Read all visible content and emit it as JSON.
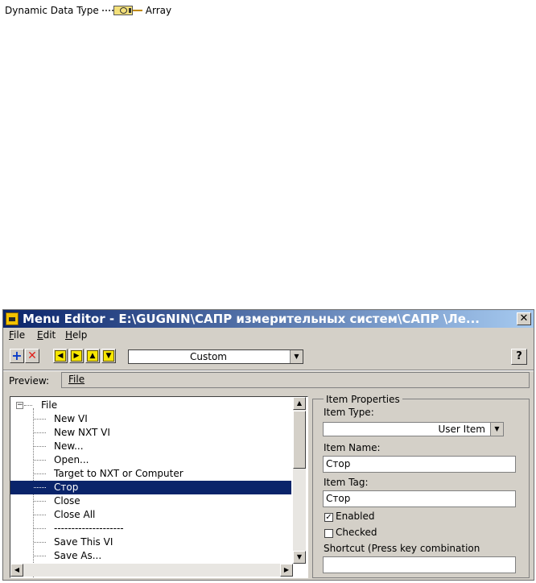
{
  "diagram": {
    "input_label": "Dynamic Data Type",
    "output_label": "Array"
  },
  "window": {
    "title": "Menu Editor - E:\\GUGNIN\\САПР измерительных систем\\САПР \\Ле...",
    "close_label": "✕"
  },
  "menubar": [
    "File",
    "Edit",
    "Help"
  ],
  "toolbar": {
    "item_type": "Custom",
    "help_label": "?"
  },
  "preview": {
    "label": "Preview:",
    "item": "File"
  },
  "tree": {
    "root": "File",
    "items": [
      "New VI",
      "New NXT VI",
      "New...",
      "Open...",
      "Target to NXT or Computer",
      "Стор",
      "Close",
      "Close All",
      "--------------------",
      "Save This VI",
      "Save As..."
    ],
    "selected_index": 5
  },
  "properties": {
    "group_title": "Item Properties",
    "item_type_label": "Item Type:",
    "item_type_value": "User Item",
    "item_name_label": "Item Name:",
    "item_name_value": "Стор",
    "item_tag_label": "Item Tag:",
    "item_tag_value": "Стор",
    "enabled_label": "Enabled",
    "enabled": true,
    "checked_label": "Checked",
    "checked": false,
    "shortcut_label": "Shortcut (Press key combination",
    "shortcut_value": ""
  }
}
